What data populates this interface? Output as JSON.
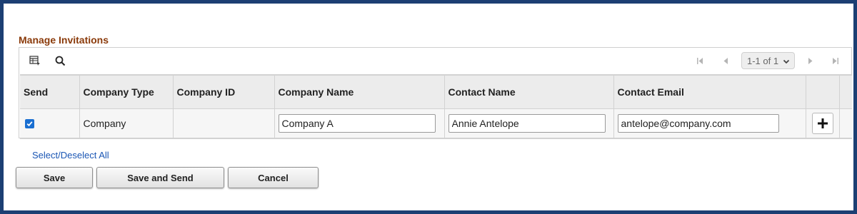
{
  "section": {
    "title": "Manage Invitations"
  },
  "toolbar": {
    "icons": [
      "grid-personalize-icon",
      "search-icon"
    ],
    "pager": {
      "range_text": "1-1 of 1"
    }
  },
  "grid": {
    "columns": [
      "Send",
      "Company Type",
      "Company ID",
      "Company Name",
      "Contact Name",
      "Contact Email"
    ],
    "rows": [
      {
        "send_checked": true,
        "company_type": "Company",
        "company_id": "",
        "company_name": "Company A",
        "contact_name": "Annie Antelope",
        "contact_email": "antelope@company.com"
      }
    ]
  },
  "links": {
    "select_all": "Select/Deselect All"
  },
  "buttons": {
    "save": "Save",
    "save_send": "Save and Send",
    "cancel": "Cancel"
  },
  "colors": {
    "frame": "#1c3f73",
    "section_title": "#8a3a0a",
    "link": "#1a56b4",
    "checkbox": "#1a6fd1"
  }
}
